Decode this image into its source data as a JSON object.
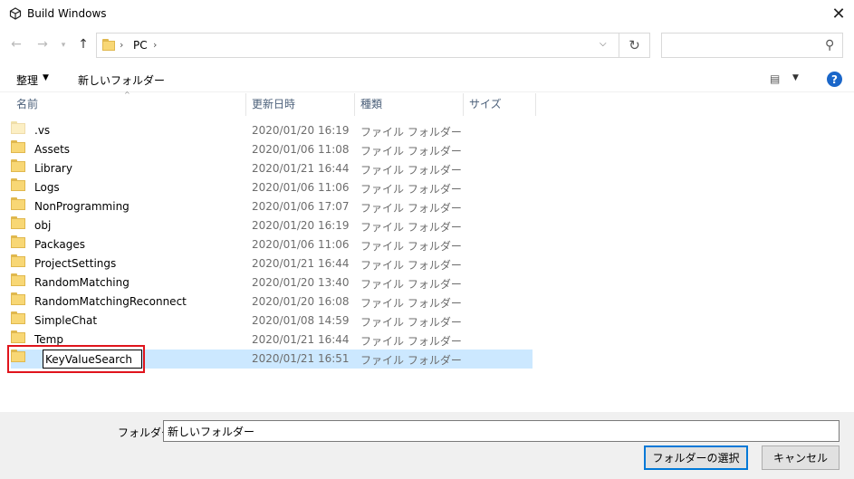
{
  "window": {
    "title": "Build Windows",
    "close_glyph": "✕"
  },
  "nav": {
    "back_glyph": "←",
    "forward_glyph": "→",
    "recent_glyph": "▾",
    "up_glyph": "↑",
    "address": {
      "separator": "›",
      "location": "PC",
      "dropdown_glyph": "⌵"
    },
    "refresh_glyph": "↻",
    "search": {
      "value": "",
      "icon": "search-icon",
      "icon_glyph": "⚲"
    }
  },
  "toolbar": {
    "organize_label": "整理",
    "dropdown_glyph": "▼",
    "new_folder_label": "新しいフォルダー",
    "view_glyph": "▤",
    "help_glyph": "?"
  },
  "columns": {
    "name": "名前",
    "date": "更新日時",
    "type": "種類",
    "size": "サイズ",
    "sort_glyph": "^"
  },
  "files": [
    {
      "name": ".vs",
      "date": "2020/01/20 16:19",
      "type": "ファイル フォルダー",
      "faded": true
    },
    {
      "name": "Assets",
      "date": "2020/01/06 11:08",
      "type": "ファイル フォルダー"
    },
    {
      "name": "Library",
      "date": "2020/01/21 16:44",
      "type": "ファイル フォルダー"
    },
    {
      "name": "Logs",
      "date": "2020/01/06 11:06",
      "type": "ファイル フォルダー"
    },
    {
      "name": "NonProgramming",
      "date": "2020/01/06 17:07",
      "type": "ファイル フォルダー"
    },
    {
      "name": "obj",
      "date": "2020/01/20 16:19",
      "type": "ファイル フォルダー"
    },
    {
      "name": "Packages",
      "date": "2020/01/06 11:06",
      "type": "ファイル フォルダー"
    },
    {
      "name": "ProjectSettings",
      "date": "2020/01/21 16:44",
      "type": "ファイル フォルダー"
    },
    {
      "name": "RandomMatching",
      "date": "2020/01/20 13:40",
      "type": "ファイル フォルダー"
    },
    {
      "name": "RandomMatchingReconnect",
      "date": "2020/01/20 16:08",
      "type": "ファイル フォルダー"
    },
    {
      "name": "SimpleChat",
      "date": "2020/01/08 14:59",
      "type": "ファイル フォルダー"
    },
    {
      "name": "Temp",
      "date": "2020/01/21 16:44",
      "type": "ファイル フォルダー"
    },
    {
      "name": "KeyValueSearch",
      "date": "2020/01/21 16:51",
      "type": "ファイル フォルダー",
      "selected": true,
      "renaming": true
    }
  ],
  "footer": {
    "folder_label": "フォルダー:",
    "folder_value": "新しいフォルダー",
    "select_button": "フォルダーの選択",
    "cancel_button": "キャンセル"
  },
  "colors": {
    "selection": "#cce8ff",
    "highlight_box": "#e0141c",
    "help_icon": "#1a66c9",
    "folder": "#f8d775"
  }
}
